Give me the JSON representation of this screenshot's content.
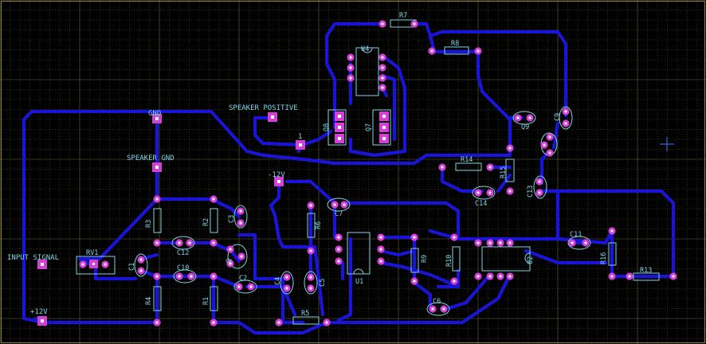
{
  "board": {
    "background": "#000000",
    "trace_color": "#1a14d6",
    "pad_color": "#d43fd6",
    "silk_color": "#7fd6e8",
    "grid_color": "#6e6a30"
  },
  "net_labels": {
    "gnd": "GND",
    "speaker_positive": "SPEAKER POSITIVE",
    "speaker_gnd": "SPEAKER GND",
    "minus12v": "-12V",
    "input_signal": "INPUT SIGNAL",
    "plus12v": "+12V",
    "pin1": "1"
  },
  "parts": {
    "R7": "R7",
    "R8": "R8",
    "R14": "R14",
    "R15": "R15",
    "R13": "R13",
    "R16": "R16",
    "R3": "R3",
    "R2": "R2",
    "R4": "R4",
    "R1": "R1",
    "R6": "R6",
    "R5": "R5",
    "R9": "R9",
    "R10": "R10",
    "U4": "U4",
    "U1": "U1",
    "U2": "U2",
    "Q8": "Q8",
    "Q7": "Q7",
    "Q9": "Q9",
    "Q3": "Q3",
    "C9": "C9",
    "C13": "C13",
    "C14": "C14",
    "C7": "C7",
    "C11": "C11",
    "C3": "C3",
    "C12": "C12",
    "C10": "C10",
    "C2": "C2",
    "C4": "C4",
    "C5": "C5",
    "C6": "C6",
    "C1": "C1",
    "RV1": "RV1",
    "Q": "Q"
  }
}
